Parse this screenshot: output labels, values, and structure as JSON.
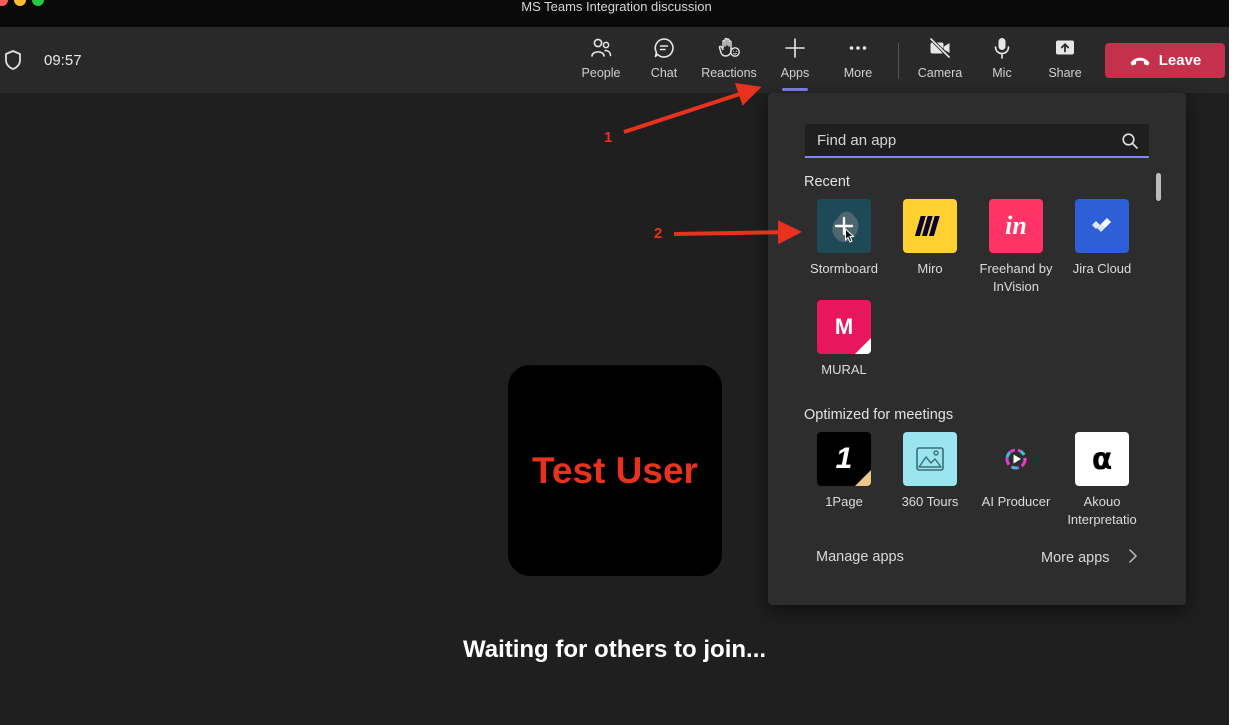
{
  "window": {
    "title": "MS Teams Integration discussion"
  },
  "meeting": {
    "timer": "09:57",
    "participant_name": "Test User",
    "waiting_text": "Waiting for others to join..."
  },
  "toolbar": {
    "people": "People",
    "chat": "Chat",
    "reactions": "Reactions",
    "apps": "Apps",
    "more": "More",
    "camera": "Camera",
    "mic": "Mic",
    "share": "Share",
    "leave": "Leave"
  },
  "apps_panel": {
    "search_placeholder": "Find an app",
    "recent_title": "Recent",
    "optimized_title": "Optimized for meetings",
    "recent": [
      {
        "name": "Stormboard",
        "icon": "stormboard-icon"
      },
      {
        "name": "Miro",
        "icon": "miro-icon"
      },
      {
        "name": "Freehand by\nInVision",
        "icon": "invision-icon"
      },
      {
        "name": "Jira Cloud",
        "icon": "jira-icon"
      },
      {
        "name": "MURAL",
        "icon": "mural-icon"
      }
    ],
    "optimized": [
      {
        "name": "1Page",
        "icon": "1page-icon"
      },
      {
        "name": "360 Tours",
        "icon": "360-tours-icon"
      },
      {
        "name": "AI Producer",
        "icon": "ai-producer-icon"
      },
      {
        "name": "Akouo\nInterpretatio",
        "icon": "akouo-icon"
      }
    ],
    "manage_apps": "Manage apps",
    "more_apps": "More apps"
  },
  "annotations": {
    "step1": "1",
    "step2": "2"
  },
  "icon_text": {
    "invision": "in",
    "mural": "M",
    "onepage": "1",
    "akouo": "α"
  },
  "colors": {
    "accent": "#7f85f5",
    "leave": "#c4314b",
    "annotation": "#e8321e",
    "stormboard": "#1e4a57",
    "miro": "#ffd02f",
    "invision": "#ff3366",
    "jira": "#2f5fd6",
    "mural": "#e8175d",
    "tours": "#9ae5ef"
  }
}
